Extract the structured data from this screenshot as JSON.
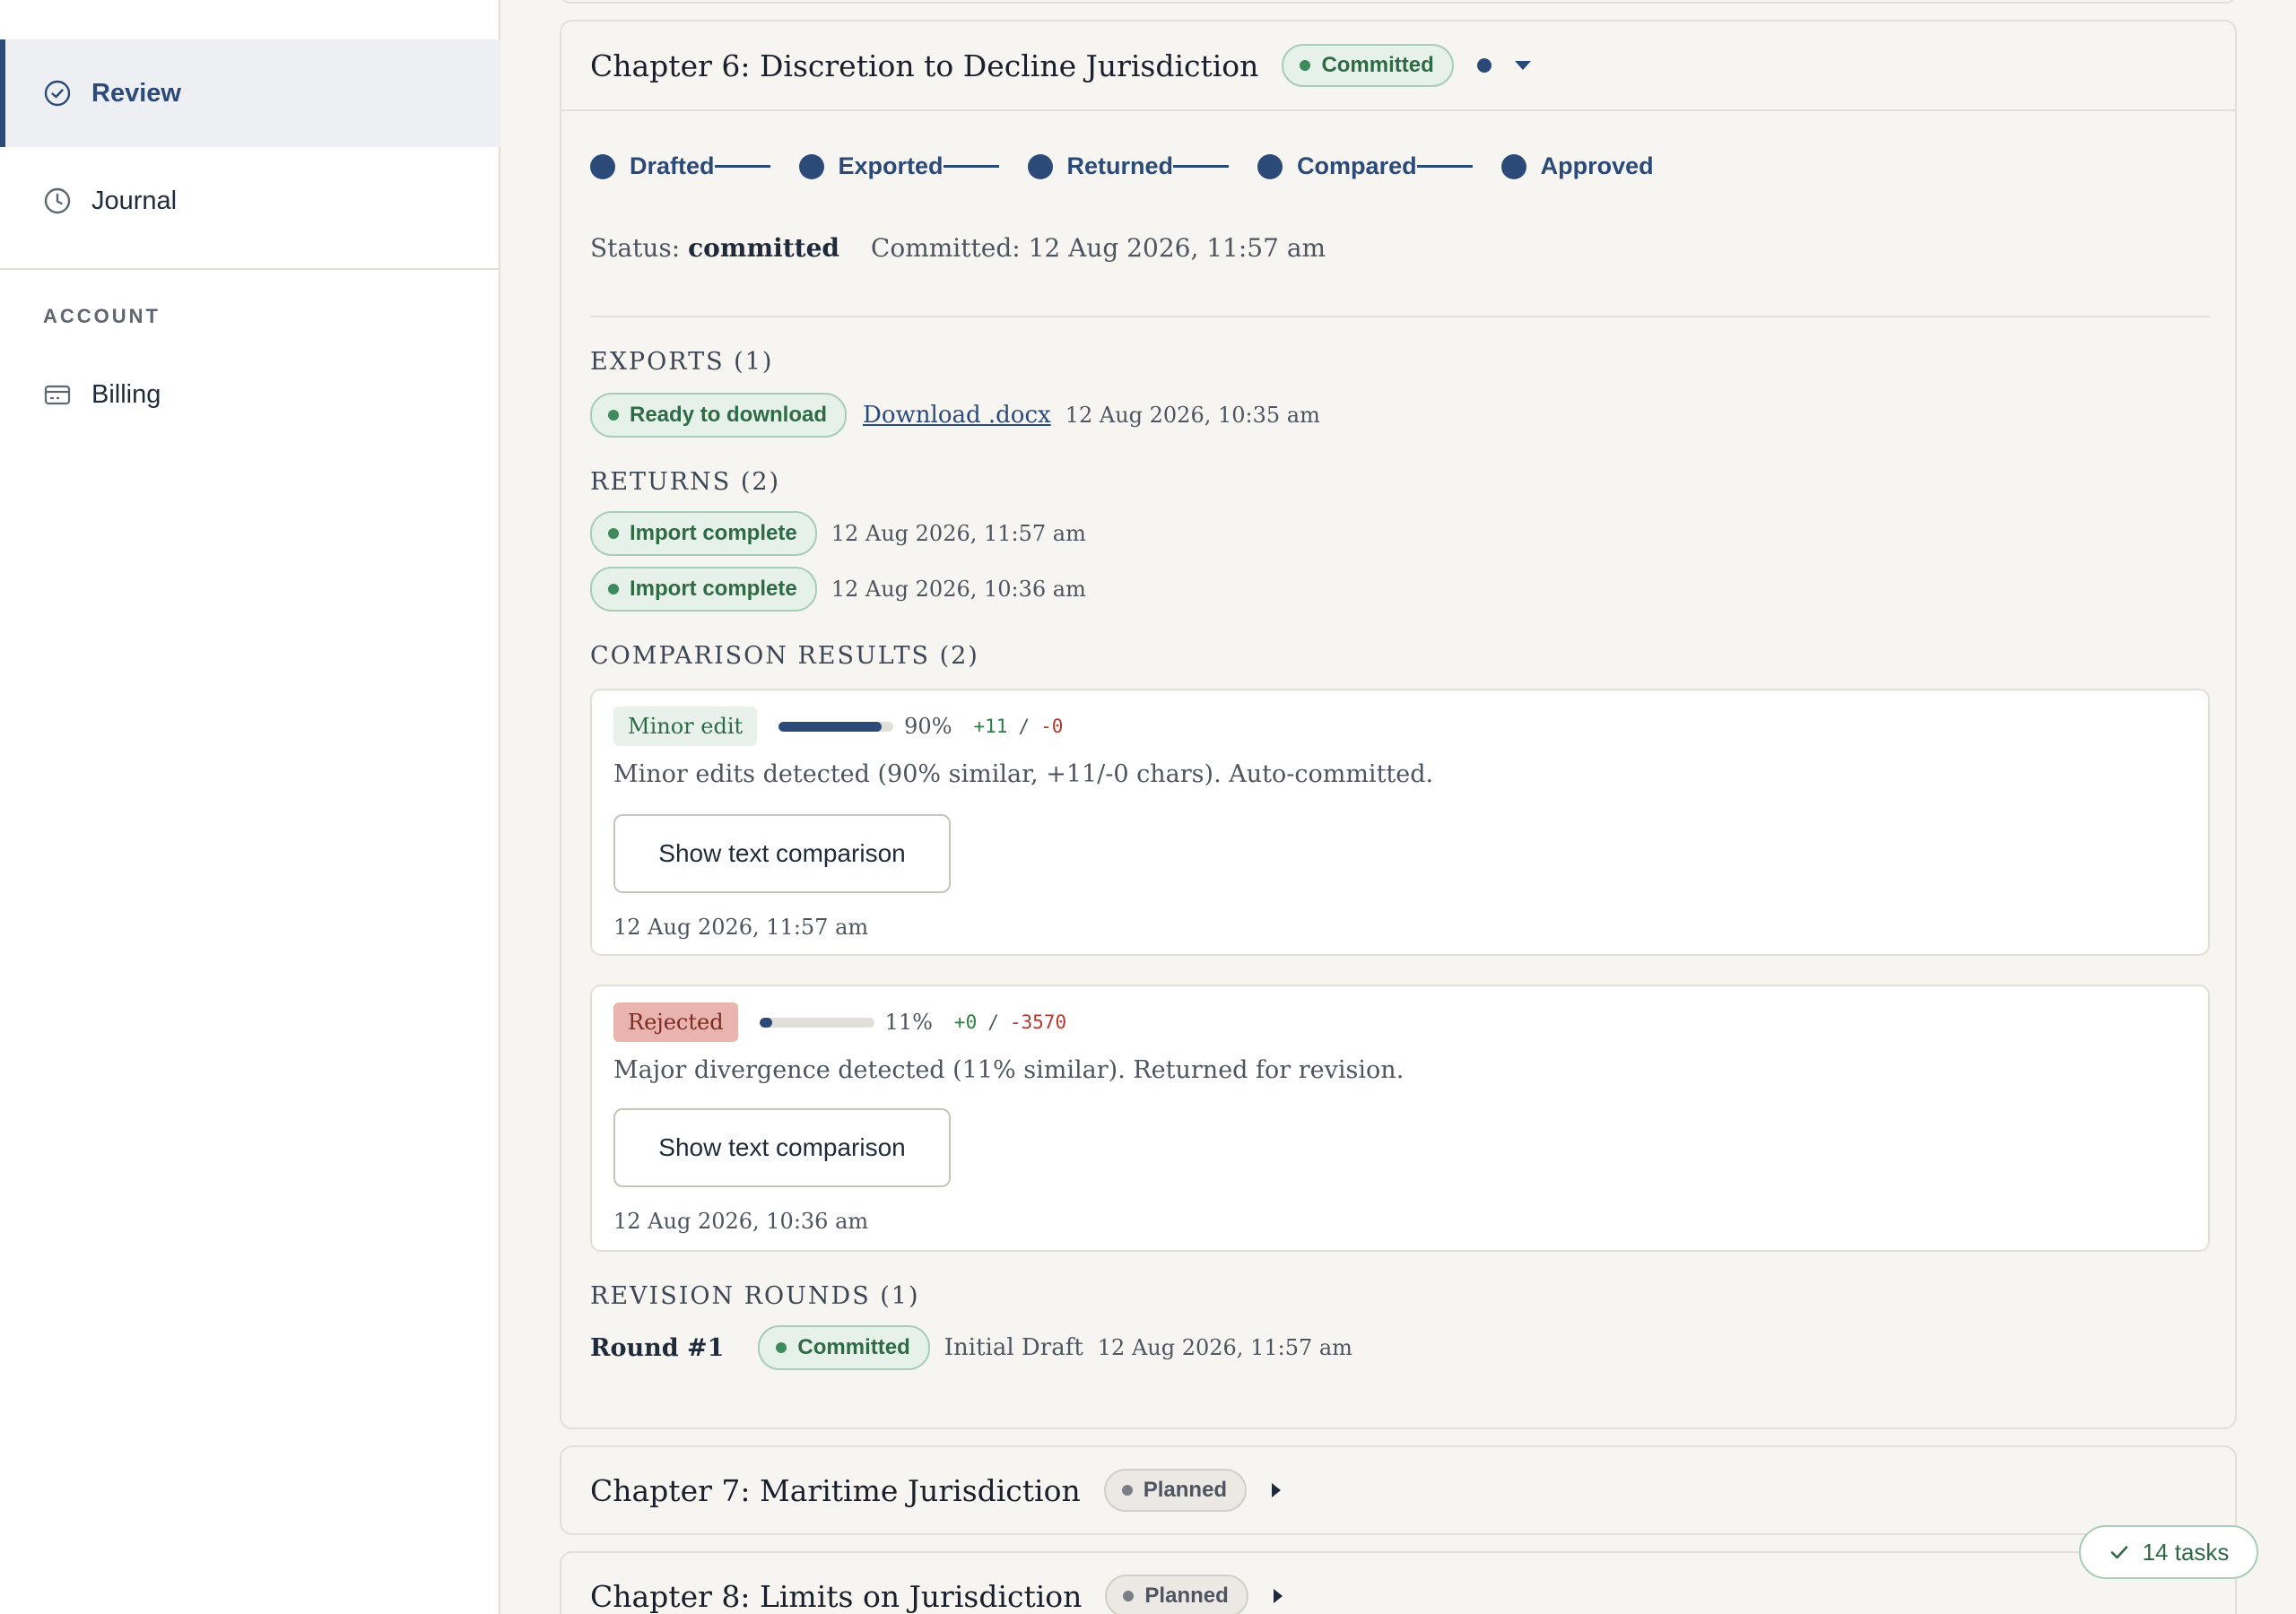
{
  "sidebar": {
    "items": [
      {
        "label": "Review",
        "icon": "check-circle-icon",
        "active": true
      },
      {
        "label": "Journal",
        "icon": "clock-icon",
        "active": false
      }
    ],
    "account_heading": "ACCOUNT",
    "account_items": [
      {
        "label": "Billing",
        "icon": "credit-card-icon"
      }
    ]
  },
  "chapter6": {
    "title": "Chapter 6: Discretion to Decline Jurisdiction",
    "status_pill": "Committed",
    "steps": [
      "Drafted",
      "Exported",
      "Returned",
      "Compared",
      "Approved"
    ],
    "status_label": "Status:",
    "status_value": "committed",
    "committed_text": "Committed: 12 Aug 2026, 11:57 am",
    "exports": {
      "heading": "EXPORTS (1)",
      "items": [
        {
          "pill": "Ready to download",
          "link": "Download .docx",
          "timestamp": "12 Aug 2026, 10:35 am"
        }
      ]
    },
    "returns": {
      "heading": "RETURNS (2)",
      "items": [
        {
          "pill": "Import complete",
          "timestamp": "12 Aug 2026, 11:57 am"
        },
        {
          "pill": "Import complete",
          "timestamp": "12 Aug 2026, 10:36 am"
        }
      ]
    },
    "comparisons": {
      "heading": "COMPARISON RESULTS (2)",
      "items": [
        {
          "tag": "Minor edit",
          "similarity": 0.9,
          "similarity_text": "90%",
          "added": "+11",
          "removed": "-0",
          "description": "Minor edits detected (90% similar, +11/-0 chars). Auto-committed.",
          "button": "Show text comparison",
          "timestamp": "12 Aug 2026, 11:57 am"
        },
        {
          "tag": "Rejected",
          "similarity": 0.11,
          "similarity_text": "11%",
          "added": "+0",
          "removed": "-3570",
          "description": "Major divergence detected (11% similar). Returned for revision.",
          "button": "Show text comparison",
          "timestamp": "12 Aug 2026, 10:36 am"
        }
      ]
    },
    "rounds": {
      "heading": "REVISION ROUNDS (1)",
      "items": [
        {
          "label": "Round #1",
          "pill": "Committed",
          "note": "Initial Draft",
          "timestamp": "12 Aug 2026, 11:57 am"
        }
      ]
    }
  },
  "chapter7": {
    "title": "Chapter 7: Maritime Jurisdiction",
    "status_pill": "Planned"
  },
  "chapter8": {
    "title": "Chapter 8: Limits on Jurisdiction",
    "status_pill": "Planned"
  },
  "tasks_badge": "14 tasks",
  "colors": {
    "accent": "#2b4a78",
    "success": "#2e6b45",
    "danger": "#b23a2e",
    "background": "#f7f5f1"
  }
}
